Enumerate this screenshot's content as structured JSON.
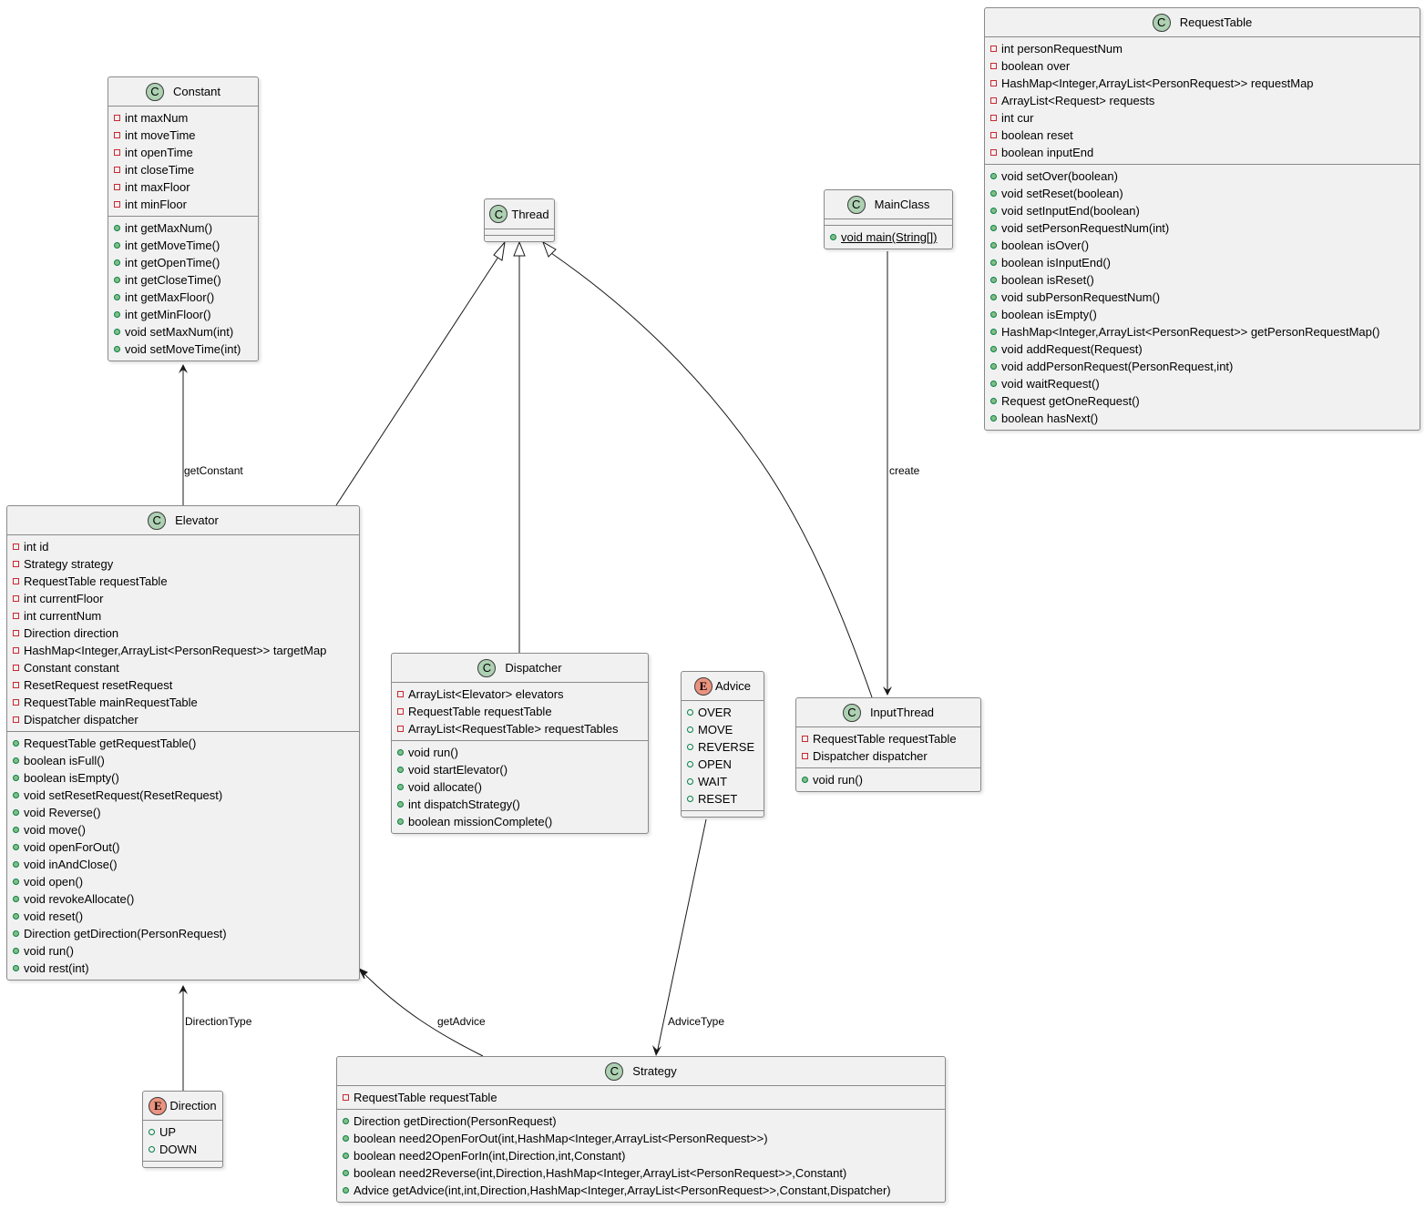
{
  "classes": {
    "constant": {
      "name": "Constant",
      "kind": "C",
      "fields": [
        "int maxNum",
        "int moveTime",
        "int openTime",
        "int closeTime",
        "int maxFloor",
        "int minFloor"
      ],
      "methods": [
        "int getMaxNum()",
        "int getMoveTime()",
        "int getOpenTime()",
        "int getCloseTime()",
        "int getMaxFloor()",
        "int getMinFloor()",
        "void setMaxNum(int)",
        "void setMoveTime(int)"
      ]
    },
    "thread": {
      "name": "Thread",
      "kind": "C"
    },
    "mainclass": {
      "name": "MainClass",
      "kind": "C",
      "methods": [
        "void main(String[])"
      ]
    },
    "requesttable": {
      "name": "RequestTable",
      "kind": "C",
      "fields": [
        "int personRequestNum",
        "boolean over",
        "HashMap<Integer,ArrayList<PersonRequest>> requestMap",
        "ArrayList<Request> requests",
        "int cur",
        "boolean reset",
        "boolean inputEnd"
      ],
      "methods": [
        "void setOver(boolean)",
        "void setReset(boolean)",
        "void setInputEnd(boolean)",
        "void setPersonRequestNum(int)",
        "boolean isOver()",
        "boolean isInputEnd()",
        "boolean isReset()",
        "void subPersonRequestNum()",
        "boolean isEmpty()",
        "HashMap<Integer,ArrayList<PersonRequest>> getPersonRequestMap()",
        "void addRequest(Request)",
        "void addPersonRequest(PersonRequest,int)",
        "void waitRequest()",
        "Request getOneRequest()",
        "boolean hasNext()"
      ]
    },
    "elevator": {
      "name": "Elevator",
      "kind": "C",
      "fields": [
        "int id",
        "Strategy strategy",
        "RequestTable requestTable",
        "int currentFloor",
        "int currentNum",
        "Direction direction",
        "HashMap<Integer,ArrayList<PersonRequest>> targetMap",
        "Constant constant",
        "ResetRequest resetRequest",
        "RequestTable mainRequestTable",
        "Dispatcher dispatcher"
      ],
      "methods": [
        "RequestTable getRequestTable()",
        "boolean isFull()",
        "boolean isEmpty()",
        "void setResetRequest(ResetRequest)",
        "void Reverse()",
        "void move()",
        "void openForOut()",
        "void inAndClose()",
        "void open()",
        "void revokeAllocate()",
        "void reset()",
        "Direction getDirection(PersonRequest)",
        "void run()",
        "void rest(int)"
      ]
    },
    "dispatcher": {
      "name": "Dispatcher",
      "kind": "C",
      "fields": [
        "ArrayList<Elevator> elevators",
        "RequestTable requestTable",
        "ArrayList<RequestTable> requestTables"
      ],
      "methods": [
        "void run()",
        "void startElevator()",
        "void allocate()",
        "int dispatchStrategy()",
        "boolean missionComplete()"
      ]
    },
    "advice": {
      "name": "Advice",
      "kind": "E",
      "constants": [
        "OVER",
        "MOVE",
        "REVERSE",
        "OPEN",
        "WAIT",
        "RESET"
      ]
    },
    "inputthread": {
      "name": "InputThread",
      "kind": "C",
      "fields": [
        "RequestTable requestTable",
        "Dispatcher dispatcher"
      ],
      "methods": [
        "void run()"
      ]
    },
    "direction": {
      "name": "Direction",
      "kind": "E",
      "constants": [
        "UP",
        "DOWN"
      ]
    },
    "strategy": {
      "name": "Strategy",
      "kind": "C",
      "fields": [
        "RequestTable requestTable"
      ],
      "methods": [
        "Direction getDirection(PersonRequest)",
        "boolean need2OpenForOut(int,HashMap<Integer,ArrayList<PersonRequest>>)",
        "boolean need2OpenForIn(int,Direction,int,Constant)",
        "boolean need2Reverse(int,Direction,HashMap<Integer,ArrayList<PersonRequest>>,Constant)",
        "Advice getAdvice(int,int,Direction,HashMap<Integer,ArrayList<PersonRequest>>,Constant,Dispatcher)"
      ]
    }
  },
  "relations": [
    {
      "from": "Elevator",
      "to": "Constant",
      "type": "association",
      "label": "getConstant"
    },
    {
      "from": "Elevator",
      "to": "Thread",
      "type": "inheritance",
      "label": ""
    },
    {
      "from": "Dispatcher",
      "to": "Thread",
      "type": "inheritance",
      "label": ""
    },
    {
      "from": "InputThread",
      "to": "Thread",
      "type": "inheritance",
      "label": ""
    },
    {
      "from": "MainClass",
      "to": "InputThread",
      "type": "association",
      "label": "create"
    },
    {
      "from": "Direction",
      "to": "Elevator",
      "type": "association",
      "label": "DirectionType"
    },
    {
      "from": "Strategy",
      "to": "Elevator",
      "type": "association",
      "label": "getAdvice"
    },
    {
      "from": "Advice",
      "to": "Strategy",
      "type": "association",
      "label": "AdviceType"
    }
  ],
  "colors": {
    "class_badge": "#add1b2",
    "enum_badge": "#eb937f",
    "private_marker": "#c82930",
    "public_marker": "#84be84",
    "box_fill": "#f1f1f1"
  }
}
